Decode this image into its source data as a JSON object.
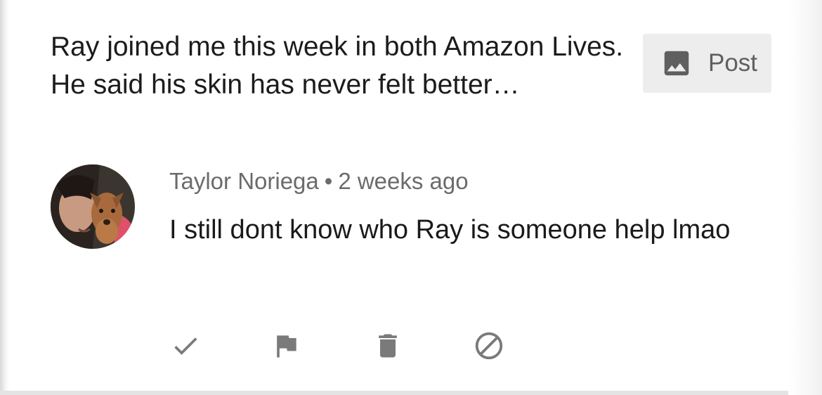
{
  "post": {
    "text": "Ray joined me this week in both Amazon Lives. He said his skin has never felt better…",
    "button_label": "Post",
    "button_icon": "image-icon"
  },
  "comment": {
    "author": "Taylor Noriega",
    "separator": "•",
    "timestamp": "2 weeks ago",
    "text": "I still dont know who Ray is someone help lmao",
    "avatar": "avatar-photo"
  },
  "actions": [
    {
      "name": "approve",
      "icon": "check-icon"
    },
    {
      "name": "report",
      "icon": "flag-icon"
    },
    {
      "name": "delete",
      "icon": "trash-icon"
    },
    {
      "name": "block",
      "icon": "block-icon"
    }
  ],
  "colors": {
    "text": "#1a1a1a",
    "meta": "#6b6b6b",
    "icon": "#757575",
    "button_bg": "#ededed"
  }
}
